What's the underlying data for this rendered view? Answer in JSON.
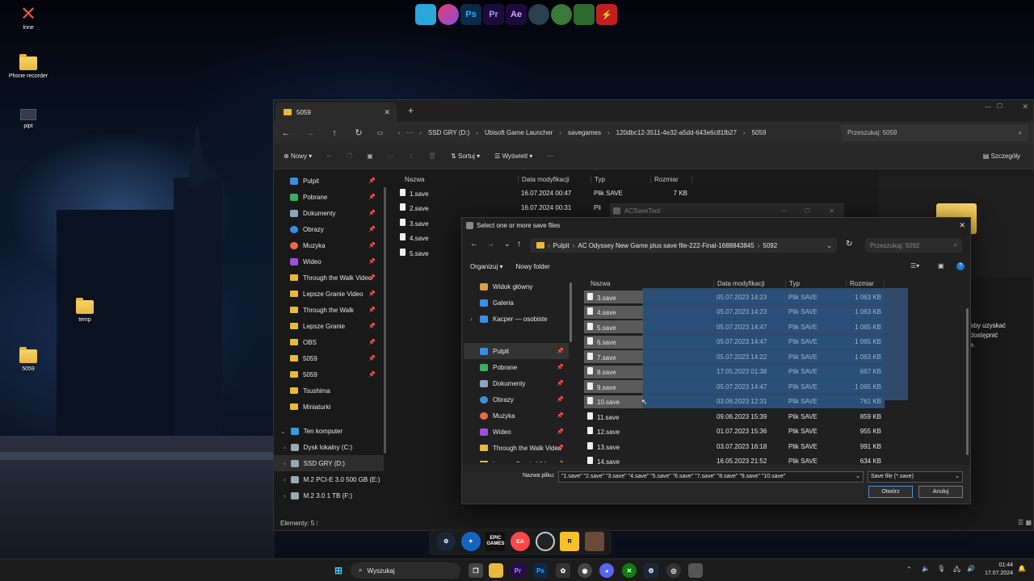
{
  "desktop": {
    "icons": [
      {
        "name": "inne-icon",
        "label": "Inne"
      },
      {
        "name": "phone-recorder-icon",
        "label": "Phone recorder"
      },
      {
        "name": "pipt-icon",
        "label": "pipt"
      },
      {
        "name": "temp-icon",
        "label": "temp"
      },
      {
        "name": "folder-5059-icon",
        "label": "5059"
      }
    ],
    "topdock": [
      "",
      "",
      "Ps",
      "Pr",
      "Ae",
      "",
      "",
      "",
      ""
    ]
  },
  "explorer": {
    "tab_title": "5059",
    "breadcrumb": [
      "SSD GRY (D:)",
      "Ubisoft Game Launcher",
      "savegames",
      "120dbc12-3511-4e32-a5dd-643e6c81fb27",
      "5059"
    ],
    "search_placeholder": "Przeszukaj: 5059",
    "toolbar": {
      "new": "Nowy",
      "sort": "Sortuj",
      "view": "Wyświetl",
      "more": "···",
      "details": "Szczegóły"
    },
    "sidebar": [
      {
        "label": "Pulpit",
        "pin": true,
        "kind": "desktop"
      },
      {
        "label": "Pobrane",
        "pin": true,
        "kind": "download"
      },
      {
        "label": "Dokumenty",
        "pin": true,
        "kind": "docs"
      },
      {
        "label": "Obrazy",
        "pin": true,
        "kind": "pics"
      },
      {
        "label": "Muzyka",
        "pin": true,
        "kind": "music"
      },
      {
        "label": "Wideo",
        "pin": true,
        "kind": "video"
      },
      {
        "label": "Through the Walk Video",
        "pin": true,
        "kind": "folder"
      },
      {
        "label": "Lepsze Granie Video",
        "pin": true,
        "kind": "folder"
      },
      {
        "label": "Through the Walk",
        "pin": true,
        "kind": "folder"
      },
      {
        "label": "Lepsze Granie",
        "pin": true,
        "kind": "folder"
      },
      {
        "label": "OBS",
        "pin": true,
        "kind": "folder"
      },
      {
        "label": "5059",
        "pin": true,
        "kind": "folder"
      },
      {
        "label": "5059",
        "pin": true,
        "kind": "folder"
      },
      {
        "label": "Tsushima",
        "pin": false,
        "kind": "folder"
      },
      {
        "label": "Miniaturki",
        "pin": false,
        "kind": "folder"
      },
      {
        "label": "Ten komputer",
        "pin": false,
        "kind": "pc"
      },
      {
        "label": "Dysk lokalny (C:)",
        "pin": false,
        "kind": "drive"
      },
      {
        "label": "SSD GRY (D:)",
        "pin": false,
        "kind": "drive"
      },
      {
        "label": "M.2 PCI-E 3.0 500 GB (E:)",
        "pin": false,
        "kind": "drive"
      },
      {
        "label": "M.2 3.0 1 TB (F:)",
        "pin": false,
        "kind": "drive"
      }
    ],
    "columns": {
      "name": "Nazwa",
      "modified": "Data modyfikacji",
      "type": "Typ",
      "size": "Rozmiar"
    },
    "files": [
      {
        "name": "1.save",
        "modified": "16.07.2024 00:47",
        "type": "Plik SAVE",
        "size": "7 KB"
      },
      {
        "name": "2.save",
        "modified": "16.07.2024 00:31",
        "type": "Pli",
        "size": ""
      },
      {
        "name": "3.save",
        "modified": "",
        "type": "",
        "size": ""
      },
      {
        "name": "4.save",
        "modified": "",
        "type": "",
        "size": ""
      },
      {
        "name": "5.save",
        "modified": "",
        "type": "",
        "size": ""
      }
    ],
    "status": "Elementy: 5",
    "right_text": [
      "aby uzyskać",
      "dostępnić",
      "e."
    ]
  },
  "acsavetool": {
    "title": "ACSaveTool"
  },
  "dialog": {
    "title": "Select one or more save files",
    "breadcrumb": [
      "Pulpit",
      "AC Odyssey New Game plus save file-222-Final-1688843845",
      "5092"
    ],
    "search_placeholder": "Przeszukaj: 5092",
    "organize": "Organizuj",
    "new_folder": "Nowy folder",
    "sidebar": [
      {
        "label": "Widok główny",
        "kind": "home",
        "pin": false
      },
      {
        "label": "Galeria",
        "kind": "gallery",
        "pin": false
      },
      {
        "label": "Kacper — osobiste",
        "kind": "cloud",
        "pin": false
      },
      {
        "label": "",
        "kind": "spacer",
        "pin": false
      },
      {
        "label": "Pulpit",
        "kind": "desktop",
        "pin": true
      },
      {
        "label": "Pobrane",
        "kind": "download",
        "pin": true
      },
      {
        "label": "Dokumenty",
        "kind": "docs",
        "pin": true
      },
      {
        "label": "Obrazy",
        "kind": "pics",
        "pin": true
      },
      {
        "label": "Muzyka",
        "kind": "music",
        "pin": true
      },
      {
        "label": "Wideo",
        "kind": "video",
        "pin": true
      },
      {
        "label": "Through the Walk Video",
        "kind": "folder",
        "pin": true
      },
      {
        "label": "Lepsze Granie Video",
        "kind": "folder",
        "pin": true
      }
    ],
    "columns": {
      "name": "Nazwa",
      "modified": "Data modyfikacji",
      "type": "Typ",
      "size": "Rozmiar"
    },
    "files": [
      {
        "name": "3.save",
        "modified": "05.07.2023 14:23",
        "type": "Plik SAVE",
        "size": "1 063 KB",
        "selected": true
      },
      {
        "name": "4.save",
        "modified": "05.07.2023 14:23",
        "type": "Plik SAVE",
        "size": "1 063 KB",
        "selected": true
      },
      {
        "name": "5.save",
        "modified": "05.07.2023 14:47",
        "type": "Plik SAVE",
        "size": "1 065 KB",
        "selected": true
      },
      {
        "name": "6.save",
        "modified": "05.07.2023 14:47",
        "type": "Plik SAVE",
        "size": "1 065 KB",
        "selected": true
      },
      {
        "name": "7.save",
        "modified": "05.07.2023 14:22",
        "type": "Plik SAVE",
        "size": "1 063 KB",
        "selected": true
      },
      {
        "name": "8.save",
        "modified": "17.05.2023 01:38",
        "type": "Plik SAVE",
        "size": "667 KB",
        "selected": true
      },
      {
        "name": "9.save",
        "modified": "05.07.2023 14:47",
        "type": "Plik SAVE",
        "size": "1 065 KB",
        "selected": true
      },
      {
        "name": "10.save",
        "modified": "03.06.2023 12:31",
        "type": "Plik SAVE",
        "size": "761 KB",
        "selected": true
      },
      {
        "name": "11.save",
        "modified": "09.06.2023 15:39",
        "type": "Plik SAVE",
        "size": "859 KB",
        "selected": false
      },
      {
        "name": "12.save",
        "modified": "01.07.2023 15:36",
        "type": "Plik SAVE",
        "size": "955 KB",
        "selected": false
      },
      {
        "name": "13.save",
        "modified": "03.07.2023 16:18",
        "type": "Plik SAVE",
        "size": "991 KB",
        "selected": false
      },
      {
        "name": "14.save",
        "modified": "16.05.2023 21:52",
        "type": "Plik SAVE",
        "size": "634 KB",
        "selected": false
      }
    ],
    "filename_label": "Nazwa pliku:",
    "filename_value": "\"1.save\" \"2.save\" \"3.save\" \"4.save\" \"5.save\" \"6.save\" \"7.save\" \"8.save\" \"9.save\" \"10.save\"",
    "filetype": "Save file (*.save)",
    "open": "Otwórz",
    "cancel": "Anuluj"
  },
  "bottom_dock": [
    "",
    "",
    "EPIC\nGAMES",
    "EA",
    "",
    "R",
    ""
  ],
  "taskbar": {
    "search": "Wyszukaj",
    "time": "01:44",
    "date": "17.07.2024"
  }
}
